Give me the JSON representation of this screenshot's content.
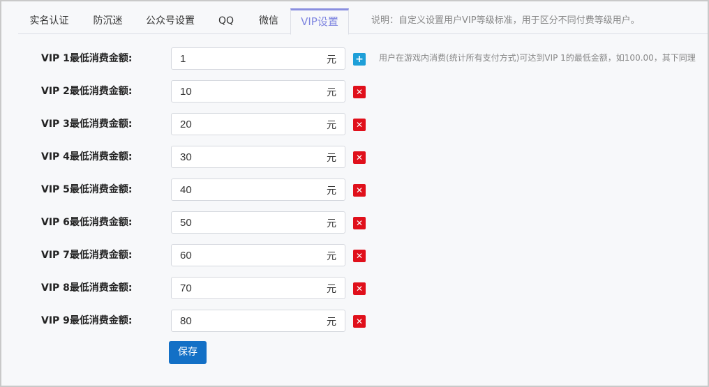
{
  "tabs": [
    {
      "label": "实名认证"
    },
    {
      "label": "防沉迷"
    },
    {
      "label": "公众号设置"
    },
    {
      "label": "QQ"
    },
    {
      "label": "微信"
    },
    {
      "label": "VIP设置"
    }
  ],
  "active_tab": "VIP设置",
  "tab_note": "说明：自定义设置用户VIP等级标准，用于区分不同付费等级用户。",
  "form": {
    "unit": "元",
    "rows": [
      {
        "label": "VIP 1最低消费金额:",
        "value": "1",
        "action": "add"
      },
      {
        "label": "VIP 2最低消费金额:",
        "value": "10",
        "action": "delete"
      },
      {
        "label": "VIP 3最低消费金额:",
        "value": "20",
        "action": "delete"
      },
      {
        "label": "VIP 4最低消费金额:",
        "value": "30",
        "action": "delete"
      },
      {
        "label": "VIP 5最低消费金额:",
        "value": "40",
        "action": "delete"
      },
      {
        "label": "VIP 6最低消费金额:",
        "value": "50",
        "action": "delete"
      },
      {
        "label": "VIP 7最低消费金额:",
        "value": "60",
        "action": "delete"
      },
      {
        "label": "VIP 8最低消费金额:",
        "value": "70",
        "action": "delete"
      },
      {
        "label": "VIP 9最低消费金额:",
        "value": "80",
        "action": "delete"
      }
    ],
    "hint": "用户在游戏内消费(统计所有支付方式)可达到VIP 1的最低金额，如100.00，其下同理",
    "add_glyph": "+",
    "delete_glyph": "✕",
    "save_label": "保存"
  },
  "colors": {
    "active_tab": "#7f86e0",
    "add_button": "#1e9fd8",
    "delete_button": "#e0101b",
    "save_button": "#1370c6"
  }
}
